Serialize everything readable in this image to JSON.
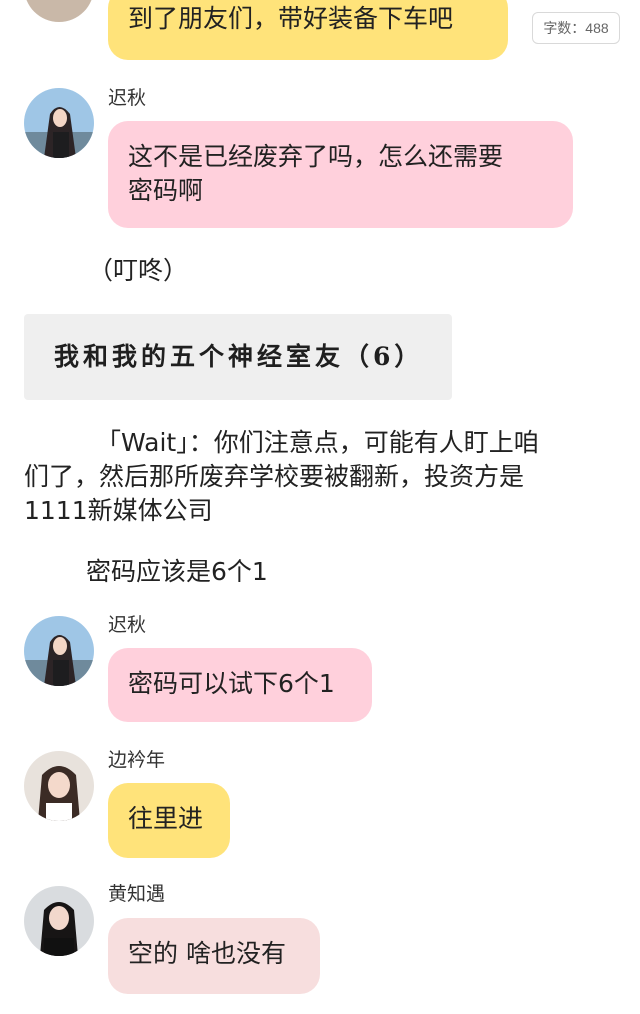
{
  "word_count": "字数：488",
  "messages": [
    {
      "speaker": "",
      "text": "到了朋友们，带好装备下车吧",
      "color": "#ffe37a"
    },
    {
      "speaker": "迟秋",
      "text_line1": "这不是已经废弃了吗，怎么还需要",
      "text_line2": "密码啊",
      "color": "#ffd0dc"
    },
    {
      "speaker": "迟秋",
      "text": "密码可以试下6个1",
      "color": "#ffd0dc"
    },
    {
      "speaker": "边衿年",
      "text": "往里进",
      "color": "#ffe37a"
    },
    {
      "speaker": "黄知遇",
      "text": "空的 啥也没有",
      "color": "#f7dede"
    }
  ],
  "narration": {
    "sound": "（叮咚）",
    "title_card": "我和我的五个神经室友（6）",
    "paragraph_line1": "「Wait」：你们注意点，可能有人盯上咱",
    "paragraph_line2": "们了，然后那所废弃学校要被翻新，投资方是",
    "paragraph_line3": "1111新媒体公司",
    "password_hint": "密码应该是6个1"
  },
  "avatars": [
    "avatar-girl-icon",
    "avatar-girl-icon",
    "avatar-girl-icon",
    "avatar-girl-icon",
    "avatar-girl-icon"
  ]
}
